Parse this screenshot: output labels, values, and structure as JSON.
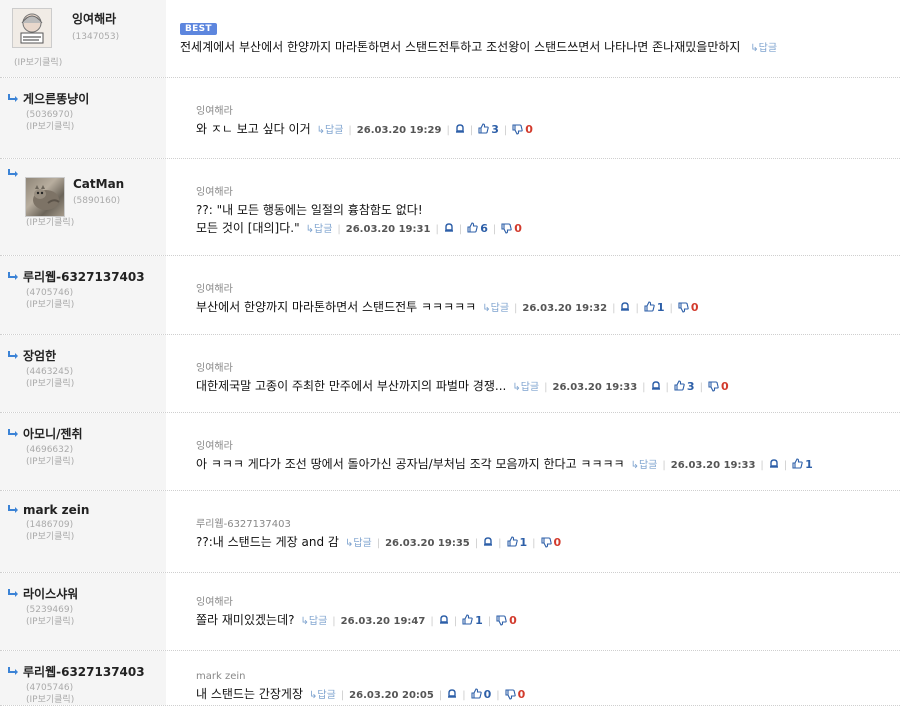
{
  "best": {
    "badge": "BEST",
    "nick": "잉여해라",
    "uid": "(1347053)",
    "ip": "(IP보기클릭)",
    "content": "전세계에서 부산에서 한양까지 마라톤하면서 스탠드전투하고 조선왕이 스탠드쓰면서 나타나면 존나재밌을만하지",
    "reply": "↳답글"
  },
  "comments": [
    {
      "nick": "게으른똥냥이",
      "uid": "(5036970)",
      "ip": "(IP보기클릭)",
      "parent": "잉여해라",
      "lines": [
        "와 ㅈㄴ 보고 싶다 이거"
      ],
      "reply": "↳답글",
      "date": "26.03.20 19:29",
      "up": "3",
      "down": "0"
    },
    {
      "nick": "CatMan",
      "uid": "(5890160)",
      "ip": "(IP보기클릭)",
      "parent": "잉여해라",
      "lines": [
        "??: \"내 모든 행동에는 일절의 흉참함도 없다!",
        "모든 것이 [대의]다.\""
      ],
      "reply": "↳답글",
      "date": "26.03.20 19:31",
      "up": "6",
      "down": "0"
    },
    {
      "nick": "루리웹-6327137403",
      "uid": "(4705746)",
      "ip": "(IP보기클릭)",
      "parent": "잉여해라",
      "lines": [
        "부산에서 한양까지 마라톤하면서 스탠드전투 ㅋㅋㅋㅋㅋ"
      ],
      "reply": "↳답글",
      "date": "26.03.20 19:32",
      "up": "1",
      "down": "0"
    },
    {
      "nick": "장엄한",
      "uid": "(4463245)",
      "ip": "(IP보기클릭)",
      "parent": "잉여해라",
      "lines": [
        "대한제국말 고종이 주최한 만주에서 부산까지의 파벌마 경쟁..."
      ],
      "reply": "↳답글",
      "date": "26.03.20 19:33",
      "up": "3",
      "down": "0"
    },
    {
      "nick": "아모니/젠취",
      "uid": "(4696632)",
      "ip": "(IP보기클릭)",
      "parent": "잉여해라",
      "lines": [
        "아 ㅋㅋㅋ 게다가 조선 땅에서 돌아가신 공자님/부처님 조각 모음까지 한다고 ㅋㅋㅋㅋ"
      ],
      "reply": "↳답글",
      "date": "26.03.20 19:33",
      "up": "1",
      "down": ""
    },
    {
      "nick": "mark zein",
      "uid": "(1486709)",
      "ip": "(IP보기클릭)",
      "parent": "루리웹-6327137403",
      "lines": [
        "??:내 스탠드는 게장 and 감"
      ],
      "reply": "↳답글",
      "date": "26.03.20 19:35",
      "up": "1",
      "down": "0"
    },
    {
      "nick": "라이스샤워",
      "uid": "(5239469)",
      "ip": "(IP보기클릭)",
      "parent": "잉여해라",
      "lines": [
        "쫄라 재미있겠는데?"
      ],
      "reply": "↳답글",
      "date": "26.03.20 19:47",
      "up": "1",
      "down": "0"
    },
    {
      "nick": "루리웹-6327137403",
      "uid": "(4705746)",
      "ip": "(IP보기클릭)",
      "parent": "mark zein",
      "lines": [
        "내 스탠드는 간장게장"
      ],
      "reply": "↳답글",
      "date": "26.03.20 20:05",
      "up": "0",
      "down": "0"
    }
  ],
  "icons": {
    "reply_arrow": "reply-arrow-icon",
    "report": "report-bell-icon",
    "thumb_up": "thumb-up-icon",
    "thumb_down": "thumb-down-icon"
  },
  "colors": {
    "best_badge": "#5d86de",
    "upvote": "#2d5fa8",
    "downvote": "#d23a2c",
    "left_bg": "#f5f5f5",
    "reply_link": "#7ea3cf"
  }
}
